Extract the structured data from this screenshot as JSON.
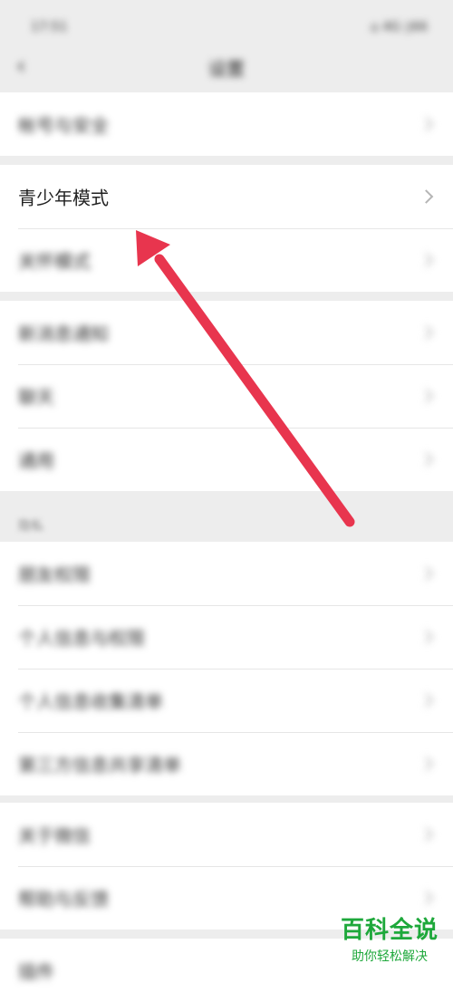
{
  "status": {
    "time": "17:51",
    "icons": "⌂ 4G ▯66"
  },
  "nav": {
    "title": "设置",
    "back_icon": "chevron-left-icon"
  },
  "groups": [
    {
      "items": [
        {
          "label": "帐号与安全"
        }
      ]
    },
    {
      "items": [
        {
          "label": "青少年模式",
          "highlighted": true
        },
        {
          "label": "关怀模式"
        }
      ]
    },
    {
      "items": [
        {
          "label": "新消息通知"
        },
        {
          "label": "聊天"
        },
        {
          "label": "通用"
        }
      ]
    },
    {
      "section_label": "隐私",
      "items": [
        {
          "label": "朋友权限"
        },
        {
          "label": "个人信息与权限"
        },
        {
          "label": "个人信息收集清单"
        },
        {
          "label": "第三方信息共享清单"
        }
      ]
    },
    {
      "items": [
        {
          "label": "关于微信"
        },
        {
          "label": "帮助与反馈"
        }
      ]
    },
    {
      "items": [
        {
          "label": "插件"
        }
      ]
    }
  ],
  "watermark": {
    "title": "百科全说",
    "subtitle": "助你轻松解决"
  },
  "annotation": {
    "color": "#e8354e",
    "icon": "red-arrow-pointing-to-youth-mode"
  }
}
